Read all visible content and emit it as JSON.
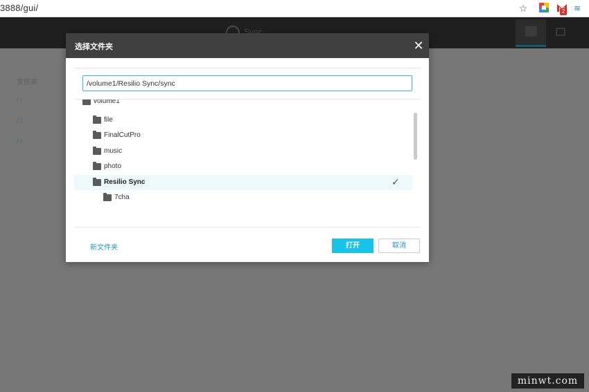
{
  "browser": {
    "url": "3888/gui/",
    "icons": [
      "star-icon",
      "extension-grid-icon",
      "gmail-icon",
      "extension-wave-icon"
    ],
    "gmail_badge": "2"
  },
  "app": {
    "logo_text": "Sync",
    "nav": [
      "folders-nav-icon",
      "devices-nav-icon"
    ],
    "accent_color": "#17c3e6"
  },
  "background": {
    "item_text": "文件夹",
    "links": [
      "/ /",
      "/ /",
      "/ /"
    ]
  },
  "dialog": {
    "title": "选择文件夹",
    "path_value": "/volume1/Resilio Sync/sync",
    "tree": {
      "partial_root": "volume1",
      "items": [
        {
          "label": "file",
          "selected": false,
          "bold": false
        },
        {
          "label": "FinalCutPro",
          "selected": false,
          "bold": false
        },
        {
          "label": "music",
          "selected": false,
          "bold": false
        },
        {
          "label": "photo",
          "selected": false,
          "bold": false
        },
        {
          "label": "Resilio Sync",
          "selected": true,
          "bold": true
        },
        {
          "label": "7cha",
          "selected": false,
          "bold": false
        }
      ]
    },
    "new_folder_label": "新文件夹",
    "open_label": "打开",
    "cancel_label": "取消"
  },
  "watermark": "minwt.com"
}
